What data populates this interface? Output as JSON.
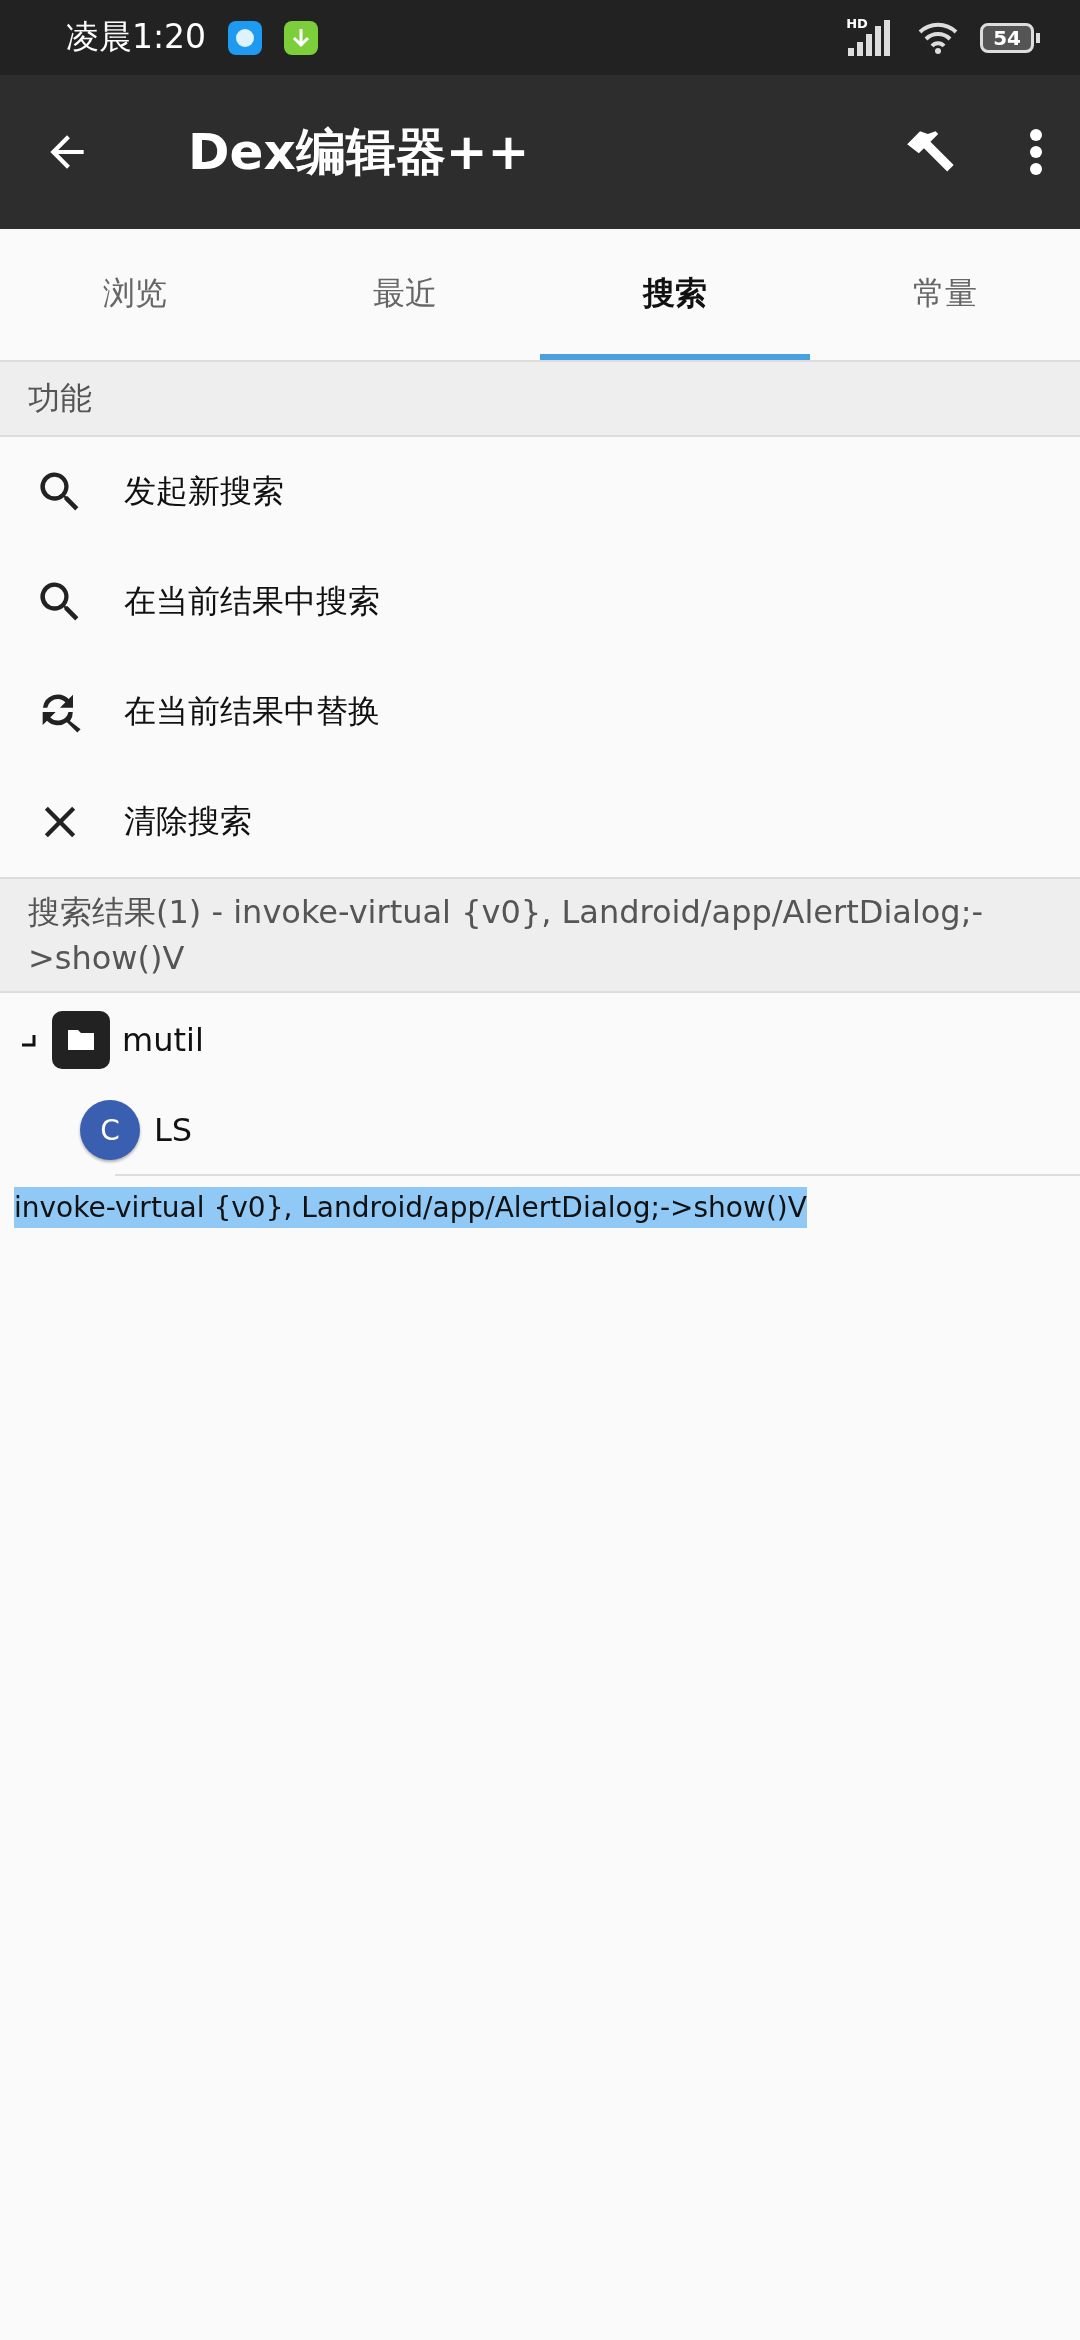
{
  "status_bar": {
    "time": "凌晨1:20",
    "network": "HD",
    "battery": "54"
  },
  "toolbar": {
    "title": "Dex编辑器++"
  },
  "tabs": [
    {
      "label": "浏览",
      "selected": false
    },
    {
      "label": "最近",
      "selected": false
    },
    {
      "label": "搜索",
      "selected": true
    },
    {
      "label": "常量",
      "selected": false
    }
  ],
  "functions": {
    "header": "功能",
    "items": [
      {
        "kind": "search",
        "label": "发起新搜索"
      },
      {
        "kind": "search",
        "label": "在当前结果中搜索"
      },
      {
        "kind": "replace",
        "label": "在当前结果中替换"
      },
      {
        "kind": "clear",
        "label": "清除搜索"
      }
    ]
  },
  "results": {
    "header": "搜索结果(1) - invoke-virtual {v0}, Landroid/app/AlertDialog;->show()V",
    "tree": [
      {
        "kind": "folder",
        "label": "mutil",
        "expanded": true,
        "children": [
          {
            "kind": "class",
            "badge": "C",
            "label": "LS",
            "children": [
              {
                "kind": "match",
                "label": "invoke-virtual {v0}, Landroid/app/AlertDialog;->show()V",
                "selected": true
              }
            ]
          }
        ]
      }
    ]
  }
}
